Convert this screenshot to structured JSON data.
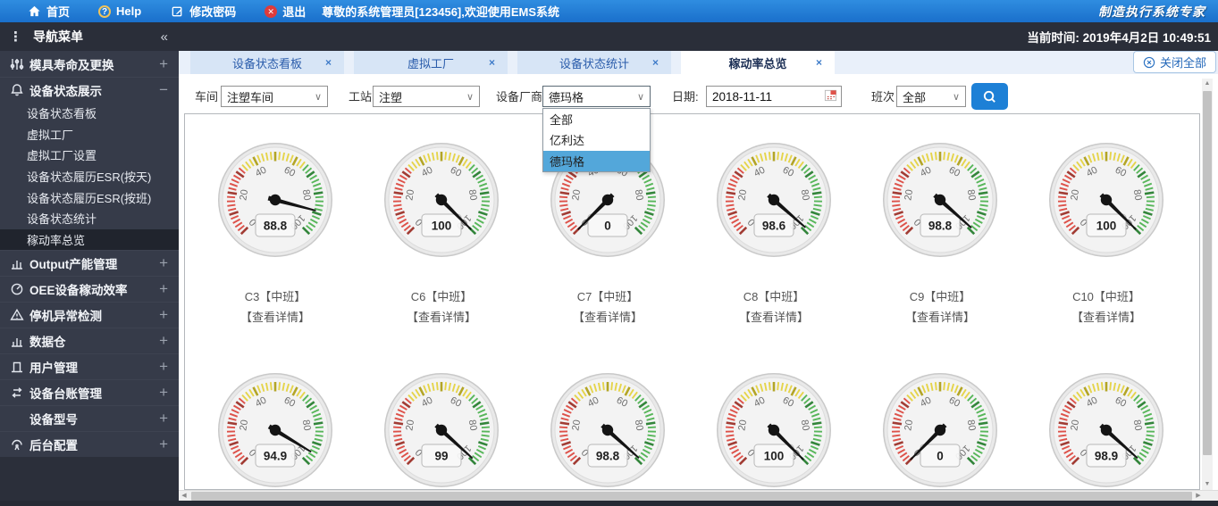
{
  "topbar": {
    "home": "首页",
    "help": "Help",
    "change_password": "修改密码",
    "logout": "退出",
    "welcome": "尊敬的系统管理员[123456],欢迎使用EMS系统",
    "brand": "制造执行系统专家"
  },
  "statusbar": {
    "time_label": "当前时间:",
    "time_value": "2019年4月2日 10:49:51"
  },
  "sidebar": {
    "title": "导航菜单",
    "collapse_glyph": "«",
    "groups": [
      {
        "label": "模具寿命及更换",
        "icon": "sliders-icon",
        "state": "collapsed"
      },
      {
        "label": "设备状态展示",
        "icon": "bell-icon",
        "state": "expanded",
        "children": [
          "设备状态看板",
          "虚拟工厂",
          "虚拟工厂设置",
          "设备状态履历ESR(按天)",
          "设备状态履历ESR(按班)",
          "设备状态统计",
          "稼动率总览"
        ],
        "active_child": "稼动率总览"
      },
      {
        "label": "Output产能管理",
        "icon": "bar-chart-icon",
        "state": "collapsed"
      },
      {
        "label": "OEE设备稼动效率",
        "icon": "gauge-icon",
        "state": "collapsed"
      },
      {
        "label": "停机异常检测",
        "icon": "warning-icon",
        "state": "collapsed"
      },
      {
        "label": "数据仓",
        "icon": "bar-chart-icon",
        "state": "collapsed"
      },
      {
        "label": "用户管理",
        "icon": "door-icon",
        "state": "collapsed"
      },
      {
        "label": "设备台账管理",
        "icon": "swap-icon",
        "state": "collapsed"
      },
      {
        "label": "设备型号",
        "icon": "none",
        "state": "collapsed"
      },
      {
        "label": "后台配置",
        "icon": "antenna-icon",
        "state": "collapsed"
      }
    ]
  },
  "tabs": {
    "items": [
      {
        "label": "设备状态看板",
        "active": false
      },
      {
        "label": "虚拟工厂",
        "active": false
      },
      {
        "label": "设备状态统计",
        "active": false
      },
      {
        "label": "稼动率总览",
        "active": true
      }
    ],
    "close_all": "关闭全部"
  },
  "filters": {
    "workshop_label": "车间",
    "workshop_value": "注塑车间",
    "station_label": "工站",
    "station_value": "注塑",
    "vendor_label": "设备厂商",
    "vendor_value": "德玛格",
    "vendor_options": [
      "全部",
      "亿利达",
      "德玛格"
    ],
    "vendor_selected": "德玛格",
    "date_label": "日期:",
    "date_value": "2018-11-11",
    "shift_label": "班次",
    "shift_value": "全部"
  },
  "chart_data": {
    "type": "gauge",
    "min": 0,
    "max": 100,
    "tick_labels": [
      0,
      20,
      40,
      60,
      80,
      100
    ],
    "zones": [
      {
        "from": 0,
        "to": 33,
        "color": "#dd5149",
        "major_color": "#a13c34"
      },
      {
        "from": 33,
        "to": 66,
        "color": "#e5d44a",
        "major_color": "#b3a527"
      },
      {
        "from": 66,
        "to": 100,
        "color": "#57b65a",
        "major_color": "#33853b"
      }
    ],
    "rows": [
      {
        "gauges": [
          {
            "name": "C3【中班】",
            "detail": "【查看详情】",
            "value": 88.8,
            "display": "88.8"
          },
          {
            "name": "C6【中班】",
            "detail": "【查看详情】",
            "value": 100,
            "display": "100"
          },
          {
            "name": "C7【中班】",
            "detail": "【查看详情】",
            "value": 0,
            "display": "0"
          },
          {
            "name": "C8【中班】",
            "detail": "【查看详情】",
            "value": 98.6,
            "display": "98.6"
          },
          {
            "name": "C9【中班】",
            "detail": "【查看详情】",
            "value": 98.8,
            "display": "98.8"
          },
          {
            "name": "C10【中班】",
            "detail": "【查看详情】",
            "value": 100,
            "display": "100"
          }
        ]
      },
      {
        "gauges": [
          {
            "name": "",
            "detail": "",
            "value": 94.9,
            "display": "94.9"
          },
          {
            "name": "",
            "detail": "",
            "value": 99,
            "display": "99"
          },
          {
            "name": "",
            "detail": "",
            "value": 98.8,
            "display": "98.8"
          },
          {
            "name": "",
            "detail": "",
            "value": 100,
            "display": "100"
          },
          {
            "name": "",
            "detail": "",
            "value": 0,
            "display": "0"
          },
          {
            "name": "",
            "detail": "",
            "value": 98.9,
            "display": "98.9"
          }
        ]
      }
    ]
  }
}
